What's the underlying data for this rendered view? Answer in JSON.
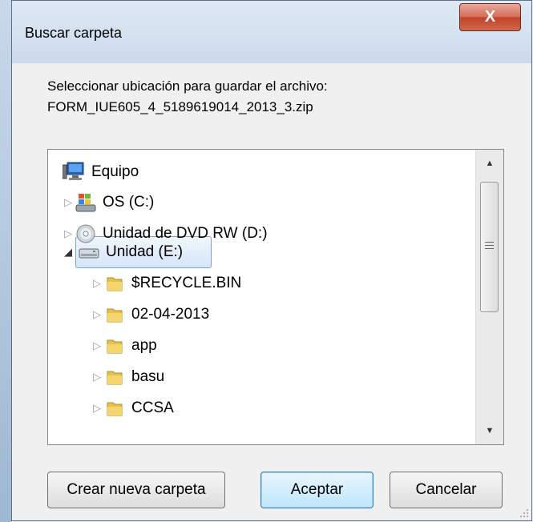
{
  "window": {
    "title": "Buscar carpeta",
    "close_label": "X"
  },
  "description": {
    "line1": "Seleccionar ubicación para guardar el archivo:",
    "line2": "FORM_IUE605_4_5189619014_2013_3.zip"
  },
  "tree": {
    "items": [
      {
        "label": "Equipo",
        "icon": "computer-icon",
        "expander": "none"
      },
      {
        "label": "OS (C:)",
        "icon": "windows-drive-icon",
        "expander": "collapsed"
      },
      {
        "label": "Unidad de DVD RW (D:)",
        "icon": "dvd-drive-icon",
        "expander": "collapsed"
      },
      {
        "label": "Unidad (E:)",
        "icon": "removable-drive-icon",
        "expander": "expanded",
        "selected": true
      },
      {
        "label": "$RECYCLE.BIN",
        "icon": "folder-icon",
        "expander": "collapsed"
      },
      {
        "label": "02-04-2013",
        "icon": "folder-icon",
        "expander": "collapsed"
      },
      {
        "label": "app",
        "icon": "folder-icon",
        "expander": "collapsed"
      },
      {
        "label": "basu",
        "icon": "folder-icon",
        "expander": "collapsed"
      },
      {
        "label": "CCSA",
        "icon": "folder-icon",
        "expander": "collapsed"
      }
    ]
  },
  "buttons": {
    "new_folder": "Crear nueva carpeta",
    "accept": "Aceptar",
    "cancel": "Cancelar"
  },
  "colors": {
    "selection": "#d5e6fa",
    "close_button": "#c2432a",
    "folder": "#e7c14c"
  }
}
